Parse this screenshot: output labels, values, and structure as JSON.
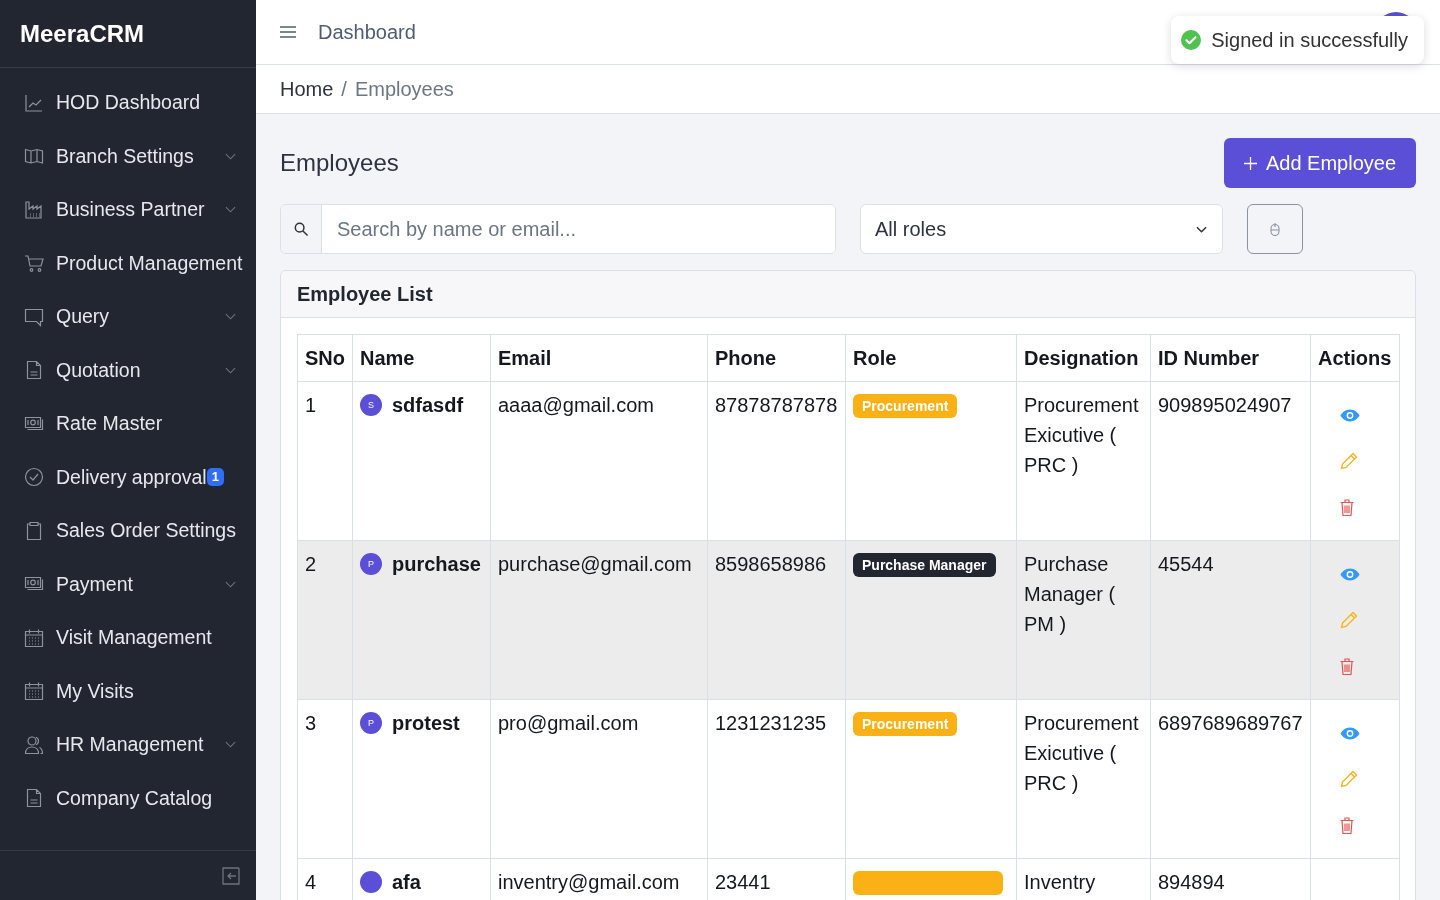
{
  "sidebar": {
    "brand": "MeeraCRM",
    "items": [
      {
        "label": "HOD Dashboard",
        "expandable": false,
        "selected": false
      },
      {
        "label": "Branch Settings",
        "expandable": true,
        "selected": false
      },
      {
        "label": "Business Partner",
        "expandable": true,
        "selected": false
      },
      {
        "label": "Product Management",
        "expandable": false,
        "selected": false
      },
      {
        "label": "Query",
        "expandable": true,
        "selected": false
      },
      {
        "label": "Quotation",
        "expandable": true,
        "selected": false
      },
      {
        "label": "Rate Master",
        "expandable": false,
        "selected": false
      },
      {
        "label": "Delivery approval",
        "badge": "1",
        "expandable": false,
        "selected": false
      },
      {
        "label": "Sales Order Settings",
        "expandable": false,
        "selected": false
      },
      {
        "label": "Payment",
        "expandable": true,
        "selected": false
      },
      {
        "label": "Visit Management",
        "expandable": false,
        "selected": false
      },
      {
        "label": "My Visits",
        "expandable": false,
        "selected": false
      },
      {
        "label": "HR Management",
        "expandable": true,
        "selected": false
      },
      {
        "label": "Company Catalog",
        "expandable": false,
        "selected": false
      }
    ]
  },
  "topbar": {
    "title": "Dashboard"
  },
  "toast": {
    "message": "Signed in successfully"
  },
  "breadcrumb": {
    "separator": "/",
    "items": [
      {
        "label": "Home",
        "selected": false
      },
      {
        "label": "Employees",
        "selected": true
      }
    ]
  },
  "page": {
    "title": "Employees",
    "add_button": "Add Employee"
  },
  "filters": {
    "search": {
      "placeholder": "Search by name or email..."
    },
    "role_select": {
      "value": "All roles"
    }
  },
  "card": {
    "title": "Employee List",
    "table": {
      "columns": [
        "SNo",
        "Name",
        "Email",
        "Phone",
        "Role",
        "Designation",
        "ID Number",
        "Actions"
      ],
      "rows": [
        {
          "sno": "1",
          "name": "sdfasdf",
          "initial": "S",
          "email": "aaaa@gmail.com",
          "phone": "87878787878",
          "role": {
            "label": "Procurement",
            "color": "#f9b115"
          },
          "designation": "Procurement Exicutive ( PRC )",
          "id_number": "909895024907",
          "highlighted": false,
          "actions": [
            {
              "kind": "view"
            },
            {
              "kind": "edit"
            },
            {
              "kind": "delete"
            }
          ]
        },
        {
          "sno": "2",
          "name": "purchase",
          "initial": "P",
          "email": "purchase@gmail.com",
          "phone": "8598658986",
          "role": {
            "label": "Purchase Manager",
            "color": "#212631"
          },
          "designation": "Purchase Manager ( PM )",
          "id_number": "45544",
          "highlighted": true,
          "actions": [
            {
              "kind": "view"
            },
            {
              "kind": "edit"
            },
            {
              "kind": "delete"
            }
          ]
        },
        {
          "sno": "3",
          "name": "protest",
          "initial": "P",
          "email": "pro@gmail.com",
          "phone": "1231231235",
          "role": {
            "label": "Procurement",
            "color": "#f9b115"
          },
          "designation": "Procurement Exicutive ( PRC )",
          "id_number": "6897689689767",
          "highlighted": false,
          "actions": [
            {
              "kind": "view"
            },
            {
              "kind": "edit"
            },
            {
              "kind": "delete"
            }
          ]
        },
        {
          "sno": "4",
          "name": "afa",
          "email": "inventry@gmail.com",
          "phone": "23441",
          "role": {
            "color": "#f9b115"
          },
          "designation": "Inventry",
          "id_number": "894894",
          "highlighted": false
        }
      ]
    }
  }
}
